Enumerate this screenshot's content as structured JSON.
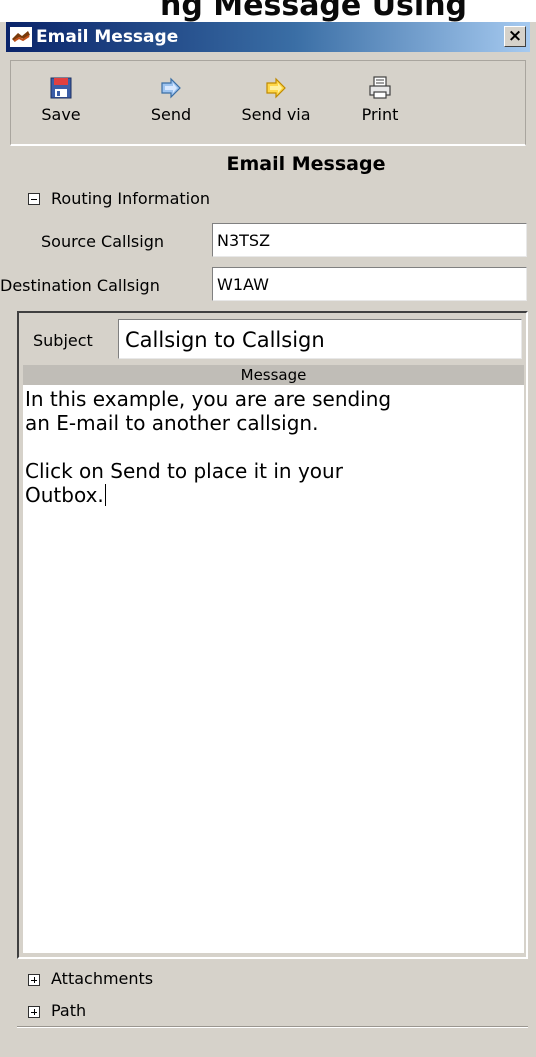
{
  "behind_window_fragment": "ng Message Using",
  "window": {
    "title": "Email Message",
    "close_label": "×"
  },
  "toolbar": {
    "buttons": [
      {
        "label": "Save",
        "icon": "save-icon"
      },
      {
        "label": "Send",
        "icon": "send-icon"
      },
      {
        "label": "Send via",
        "icon": "send-via-icon"
      },
      {
        "label": "Print",
        "icon": "print-icon"
      }
    ]
  },
  "form": {
    "title": "Email Message",
    "routing_section": "Routing Information",
    "source_label": "Source Callsign",
    "source_value": "N3TSZ",
    "destination_label": "Destination Callsign",
    "destination_value": "W1AW",
    "subject_label": "Subject",
    "subject_value": "Callsign to Callsign",
    "message_header": "Message",
    "message_lines": [
      "In this example, you are are sending",
      "an E-mail to another callsign.",
      "Click on Send to place it in your",
      "Outbox."
    ],
    "attachments_section": "Attachments",
    "path_section": "Path"
  },
  "colors": {
    "titlebar_start": "#0a246a",
    "titlebar_end": "#a6caf0",
    "window_bg": "#d6d2ca"
  }
}
